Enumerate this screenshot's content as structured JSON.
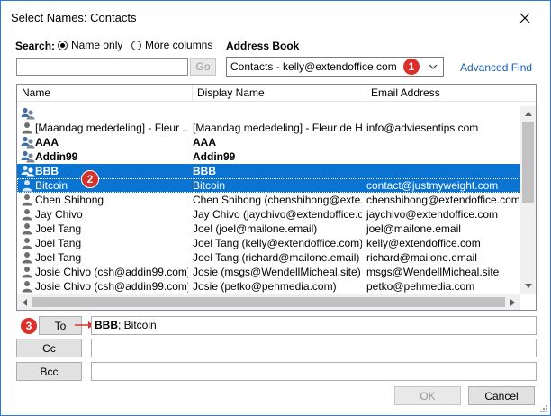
{
  "window": {
    "title": "Select Names: Contacts"
  },
  "search": {
    "label": "Search:",
    "option_name_only": "Name only",
    "option_more_columns": "More columns",
    "selected": "Name only",
    "query": "",
    "go_label": "Go"
  },
  "address_book": {
    "label": "Address Book",
    "selected": "Contacts - kelly@extendoffice.com",
    "advanced_find": "Advanced Find"
  },
  "list": {
    "columns": [
      "Name",
      "Display Name",
      "Email Address"
    ],
    "rows": [
      {
        "type": "group",
        "name": "",
        "display": "",
        "email": "",
        "bold": false,
        "selected": false
      },
      {
        "type": "person",
        "name": "[Maandag mededeling] - Fleur ...",
        "display": "[Maandag mededeling] - Fleur de H...",
        "email": "info@adviesentips.com",
        "bold": false,
        "selected": false
      },
      {
        "type": "group",
        "name": "AAA",
        "display": "AAA",
        "email": "",
        "bold": true,
        "selected": false
      },
      {
        "type": "group",
        "name": "Addin99",
        "display": "Addin99",
        "email": "",
        "bold": true,
        "selected": false
      },
      {
        "type": "group",
        "name": "BBB",
        "display": "BBB",
        "email": "",
        "bold": true,
        "selected": true
      },
      {
        "type": "person",
        "name": "Bitcoin",
        "display": "Bitcoin",
        "email": "contact@justmyweight.com",
        "bold": false,
        "selected": true
      },
      {
        "type": "person",
        "name": "Chen Shihong",
        "display": "Chen Shihong (chenshihong@exte...",
        "email": "chenshihong@extendoffice.com",
        "bold": false,
        "selected": false
      },
      {
        "type": "person",
        "name": "Jay Chivo",
        "display": "Jay Chivo (jaychivo@extendoffice.c...",
        "email": "jaychivo@extendoffice.com",
        "bold": false,
        "selected": false
      },
      {
        "type": "person",
        "name": "Joel Tang",
        "display": "Joel (joel@mailone.email)",
        "email": "joel@mailone.email",
        "bold": false,
        "selected": false
      },
      {
        "type": "person",
        "name": "Joel Tang",
        "display": "Joel Tang (kelly@extendoffice.com)",
        "email": "kelly@extendoffice.com",
        "bold": false,
        "selected": false
      },
      {
        "type": "person",
        "name": "Joel Tang",
        "display": "Joel Tang (richard@mailone.email)",
        "email": "richard@mailone.email",
        "bold": false,
        "selected": false
      },
      {
        "type": "person",
        "name": "Josie Chivo (csh@addin99.com)",
        "display": "Josie (msgs@WendellMicheal.site)",
        "email": "msgs@WendellMicheal.site",
        "bold": false,
        "selected": false
      },
      {
        "type": "person",
        "name": "Josie Chivo (csh@addin99.com)",
        "display": "Josie (petko@pehmedia.com)",
        "email": "petko@pehmedia.com",
        "bold": false,
        "selected": false
      }
    ]
  },
  "recipients": {
    "to_label": "To",
    "to_value_1": "BBB",
    "to_separator": "; ",
    "to_value_2": "Bitcoin",
    "cc_label": "Cc",
    "cc_value": "",
    "bcc_label": "Bcc",
    "bcc_value": ""
  },
  "footer": {
    "ok_label": "OK",
    "cancel_label": "Cancel"
  },
  "annotations": {
    "step1": "1",
    "step2": "2",
    "step3": "3"
  },
  "colors": {
    "accent": "#0a74d0",
    "border": "#2b79d6",
    "badge": "#d9302b",
    "link": "#1a5fb4"
  },
  "icons": {
    "group": "contact-group-icon",
    "person": "contact-person-icon"
  }
}
